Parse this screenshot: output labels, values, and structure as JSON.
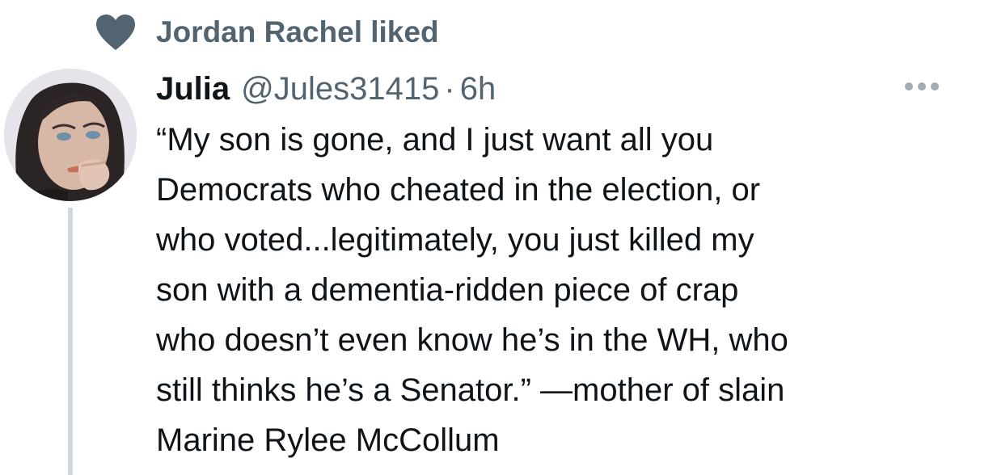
{
  "social_context": {
    "icon": "heart-icon",
    "text": "Jordan Rachel liked"
  },
  "tweet": {
    "author": {
      "display_name": "Julia",
      "handle": "@Jules31415",
      "avatar": "avatar"
    },
    "separator": "·",
    "timestamp": "6h",
    "more_icon": "more-options-icon",
    "text_lines": [
      "“My son is gone, and I just want all you",
      "Democrats who cheated in the election, or",
      "who voted...legitimately, you just killed my",
      "son with a dementia-ridden piece of crap",
      "who doesn’t even know he’s in the WH, who",
      "still thinks he’s a Senator.” —mother of slain",
      "Marine Rylee McCollum"
    ]
  },
  "colors": {
    "text_primary": "#0f1419",
    "text_secondary": "#536471",
    "heart": "#536471",
    "thread_line": "#cfd9de",
    "more_dots": "#a3acb3"
  }
}
